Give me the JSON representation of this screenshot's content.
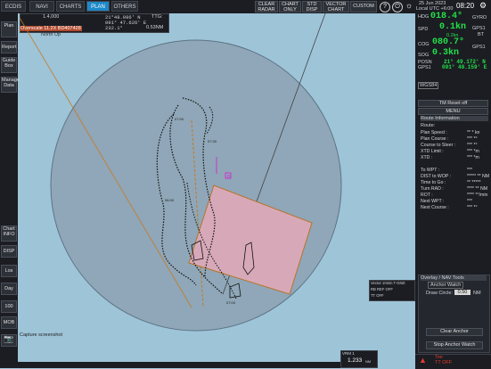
{
  "top_tabs": [
    "ECDIS",
    "NAVI",
    "CHARTS",
    "PLAN",
    "OTHERS"
  ],
  "top_buttons": [
    "CLEAR RADAR",
    "CHART ONLY",
    "STD DISP",
    "VECTOR CHART",
    "CUSTOM"
  ],
  "datetime": {
    "date": "25 Jun 2023",
    "local": "Local UTC +6:00",
    "time": "08:20"
  },
  "cursor_box": {
    "range": "1.4,000",
    "lat": "21°48.996' N",
    "lon": "091° 47.626' E",
    "brg": "232.1°",
    "dist": "0.53NM",
    "ttg": "TTG:"
  },
  "left_buttons": [
    "Plan",
    "Report",
    "Guide Box",
    "Manage Data",
    "Chart INFO",
    "DISP",
    "Los",
    "Day",
    "100",
    "MOB"
  ],
  "chart_status": {
    "overscale": "Overscale 11.2X  BD407428",
    "orientation": "North Up"
  },
  "nav": {
    "hdg_label": "HDG",
    "hdg": "018.4°",
    "hdg_src": "GYRO",
    "spd_label": "SPD",
    "spd": "0.1kn",
    "spd_src1": "GPS1",
    "spd_src2": "BT",
    "spd_sub": "0.2kn",
    "cog_label": "COG",
    "cog": "080.7°",
    "cog_src": "GPS1",
    "sog_label": "SOG",
    "sog": "0.3kn",
    "posn_label": "POSN",
    "posn_src": "GPS1",
    "lat": "21° 49.172' N",
    "lon": "091° 48.159' E",
    "datum": "WGS84"
  },
  "tm_reset": "TM Reset off",
  "menu": "MENU",
  "route": {
    "header": "Route Information",
    "route_label": "Route:",
    "rows": [
      {
        "label": "Plan Speed :",
        "value": "** * kn"
      },
      {
        "label": "Plan Course :",
        "value": "*** *°"
      },
      {
        "label": "Course to Steer :",
        "value": "*** *°"
      },
      {
        "label": "XTD Limit :",
        "value": "*** *m"
      },
      {
        "label": "XTD :",
        "value": "*** *m"
      },
      {
        "label": "To WPT :",
        "value": "***"
      },
      {
        "label": "DIST to WOP :",
        "value": "***** ** NM"
      },
      {
        "label": "Time to Go :",
        "value": "** *****"
      },
      {
        "label": "Turn RAD :",
        "value": "**** ** NM"
      },
      {
        "label": "ROT :",
        "value": "**** *°/min"
      },
      {
        "label": "Next WPT :",
        "value": "***"
      },
      {
        "label": "Next Course :",
        "value": "*** *°"
      }
    ]
  },
  "overlay": {
    "header": "Overlay / NAV Tools",
    "subheader": "Anchor Watch",
    "draw_circle_label": "Draw Circle:",
    "draw_circle_value": "0.50",
    "draw_circle_unit": "NM",
    "clear_anchor": "Clear Anchor",
    "stop_anchor": "Stop Anchor Watch"
  },
  "vector_box": {
    "line1": "Vector 10min  T-GND",
    "line2": "RB REF OFF",
    "line3": "TT OFF"
  },
  "range_box": {
    "label": "VRM 1",
    "value": "1.233",
    "unit": "NM"
  },
  "bottom_left": "Capture screenshot",
  "alarm": {
    "line1": "Tee",
    "line2": "TT OFF"
  },
  "map_labels": [
    "B",
    "07:00",
    "07:30",
    "06:00",
    "07:00"
  ],
  "colors": {
    "accent": "#1e88c8",
    "green": "#22e04a",
    "circle_fill": "#8fa7b8",
    "area_fill": "#d7a9b8",
    "area_stroke": "#b8732a"
  }
}
